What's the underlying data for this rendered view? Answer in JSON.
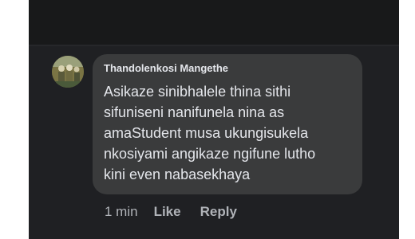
{
  "comment": {
    "author": "Thandolenkosi Mangethe",
    "text": "Asikaze sinibhalele thina sithi\nsifuniseni nanifunela nina as\namaStudent musa ukungisukela\nnkosiyami angikaze ngifune lutho\nkini even nabasekhaya",
    "timestamp": "1 min",
    "like_label": "Like",
    "reply_label": "Reply"
  },
  "avatar_icon": "profile-photo-icon",
  "colors": {
    "background": "#1f2023",
    "bubble": "#3a3b3c",
    "text": "#e4e6eb",
    "muted": "#b0b3b8"
  }
}
